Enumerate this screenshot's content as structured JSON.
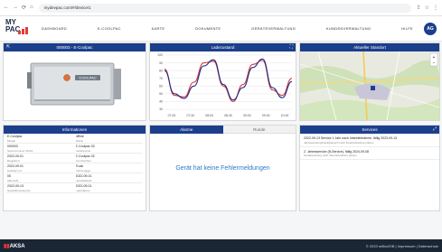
{
  "browser": {
    "url": "mydevpac.com/#/device/1",
    "nav_icons": [
      "back-icon",
      "forward-icon",
      "reload-icon",
      "home-icon"
    ]
  },
  "app": {
    "logo_top": "MY",
    "logo_bottom": "PAC",
    "menu": [
      "DASHBOARD",
      "E-COOLPAC",
      "KARTE",
      "DOKUMENTE",
      "GERÄTEVERWALTUNG",
      "KUNDENVERWALTUNG",
      "HILFE"
    ],
    "avatar": "AG"
  },
  "panels": {
    "device": {
      "title": "000003 - E-Coolpac"
    },
    "chart": {
      "title": "Ladezustand"
    },
    "map": {
      "title": "Aktueller Standort"
    },
    "info": {
      "title": "Informationen"
    },
    "alarm": {
      "tab_alarms": "Alarme",
      "tab_runs": "Runde",
      "empty": "Gerät hat keine Fehlermeldungen"
    },
    "service": {
      "title": "Services"
    }
  },
  "info_rows": [
    {
      "left_v": "E-Coolpac",
      "left_k": "Modell",
      "right_v": "offline",
      "right_k": "Status"
    },
    {
      "left_v": "000003",
      "left_k": "Seriennummer AKSA",
      "right_v": "E-Coolpac 02",
      "right_k": "Gerätename"
    },
    {
      "left_v": "2022-09-01",
      "left_k": "Registriert",
      "right_v": "E-Coolpac 02",
      "right_k": "Kennzeichen"
    },
    {
      "left_v": "2022-09-01",
      "left_k": "Geliefert am",
      "right_v": "Truck",
      "right_k": "Fahrzeugtyp"
    },
    {
      "left_v": "05",
      "left_k": "Akkuzahl",
      "right_v": "2022-09-01",
      "right_k": "Herstelldatum"
    },
    {
      "left_v": "2022-09-13",
      "left_k": "Gewährleistung bis",
      "right_v": "2022-09-01",
      "right_k": "Lieferdatum"
    }
  ],
  "services": [
    {
      "title": "2022-09-13 Service 1 Jahr nach Inbetriebnahme, fällig 2023-09-13",
      "desc": "Jahreswartung/Gerätetausch nach Inbetriebnahme planen"
    },
    {
      "title": "2. Jahresservice (B-Service), fällig 2024-09-08",
      "desc": "Gerätewartung nach Inbetriebnahme planen"
    }
  ],
  "chart_data": {
    "type": "line",
    "title": "Ladezustand",
    "x": [
      "07:00",
      "07:30",
      "08:00",
      "08:30",
      "09:00",
      "09:30",
      "10:00"
    ],
    "ylim": [
      30,
      100
    ],
    "yticks": [
      100,
      90,
      80,
      70,
      60,
      50,
      40,
      30
    ],
    "series": [
      {
        "color": "#d93a3a",
        "values": [
          82,
          48,
          46,
          65,
          90,
          92,
          60,
          40,
          62,
          88,
          93,
          55,
          48,
          70
        ]
      },
      {
        "color": "#1c2a8c",
        "values": [
          80,
          50,
          44,
          60,
          86,
          94,
          62,
          42,
          58,
          84,
          95,
          58,
          45,
          66
        ]
      }
    ],
    "grid": true,
    "legend": "none"
  },
  "footer": {
    "brand": "AKSA",
    "links": "© 2023 m8buX0B | Impressum | Datenschutz"
  },
  "colors": {
    "header": "#1c3f8c",
    "accent": "#e23b3b",
    "notice": "#2b7bc8"
  }
}
